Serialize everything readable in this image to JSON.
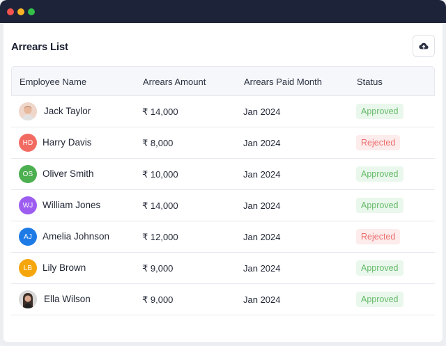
{
  "window": {
    "controls": [
      "close",
      "minimize",
      "maximize"
    ]
  },
  "page": {
    "title": "Arrears List",
    "upload_icon": "cloud-upload-icon"
  },
  "table": {
    "headers": [
      "Employee Name",
      "Arrears Amount",
      "Arrears Paid Month",
      "Status"
    ],
    "rows": [
      {
        "name": "Jack Taylor",
        "initials": "",
        "avatar": "photo",
        "avatar_color": "#f2d5c8",
        "amount": "₹ 14,000",
        "month": "Jan 2024",
        "status": "Approved"
      },
      {
        "name": "Harry Davis",
        "initials": "HD",
        "avatar": "initials",
        "avatar_color": "#f26b63",
        "amount": "₹ 8,000",
        "month": "Jan 2024",
        "status": "Rejected"
      },
      {
        "name": "Oliver Smith",
        "initials": "OS",
        "avatar": "initials",
        "avatar_color": "#4caf50",
        "amount": "₹ 10,000",
        "month": "Jan 2024",
        "status": "Approved"
      },
      {
        "name": "William Jones",
        "initials": "WJ",
        "avatar": "initials",
        "avatar_color": "#9c5df0",
        "amount": "₹ 14,000",
        "month": "Jan 2024",
        "status": "Approved"
      },
      {
        "name": "Amelia Johnson",
        "initials": "AJ",
        "avatar": "initials",
        "avatar_color": "#1e7be6",
        "amount": "₹ 12,000",
        "month": "Jan 2024",
        "status": "Rejected"
      },
      {
        "name": "Lily Brown",
        "initials": "LB",
        "avatar": "initials",
        "avatar_color": "#f4a60c",
        "amount": "₹ 9,000",
        "month": "Jan 2024",
        "status": "Approved"
      },
      {
        "name": "Ella Wilson",
        "initials": "",
        "avatar": "photo",
        "avatar_color": "#4a3a35",
        "amount": "₹ 9,000",
        "month": "Jan 2024",
        "status": "Approved"
      }
    ]
  },
  "colors": {
    "titlebar": "#1d2339",
    "approved_bg": "#eaf7ec",
    "approved_text": "#66bb6a",
    "rejected_bg": "#fdecec",
    "rejected_text": "#ec6b6b"
  }
}
